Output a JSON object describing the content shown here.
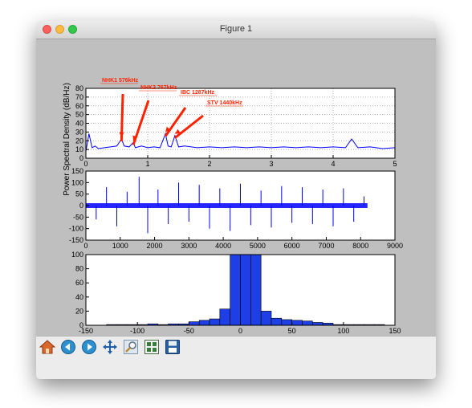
{
  "window": {
    "title": "Figure 1"
  },
  "toolbar": {
    "icons": [
      "home-icon",
      "back-icon",
      "forward-icon",
      "pan-icon",
      "zoom-icon",
      "subplots-icon",
      "save-icon"
    ]
  },
  "colors": {
    "series": "#0000ff",
    "annotation": "#ff2200",
    "canvas": "#bfbfbf",
    "hist_fill": "#1f3fe6"
  },
  "chart_data": [
    {
      "type": "line",
      "ylabel": "Power Spectral Density (dB/Hz)",
      "xlim": [
        0,
        5
      ],
      "ylim": [
        0,
        80
      ],
      "xticks": [
        "0",
        "1",
        "2",
        "3",
        "4",
        "5"
      ],
      "yticks": [
        "0",
        "10",
        "20",
        "30",
        "40",
        "50",
        "60",
        "70",
        "80"
      ],
      "grid": true,
      "x": [
        0.0,
        0.05,
        0.1,
        0.15,
        0.2,
        0.3,
        0.4,
        0.5,
        0.576,
        0.62,
        0.7,
        0.767,
        0.8,
        0.9,
        1.0,
        1.1,
        1.2,
        1.287,
        1.33,
        1.38,
        1.44,
        1.5,
        1.6,
        1.8,
        2.0,
        2.2,
        2.4,
        2.6,
        2.8,
        3.0,
        3.2,
        3.4,
        3.6,
        3.8,
        4.0,
        4.2,
        4.3,
        4.4,
        4.6,
        4.8,
        5.0
      ],
      "values": [
        8,
        28,
        12,
        14,
        11,
        12,
        13,
        14,
        22,
        14,
        13,
        18,
        12,
        14,
        12,
        13,
        12,
        28,
        14,
        13,
        26,
        13,
        14,
        12,
        13,
        12,
        13,
        12,
        13,
        12,
        13,
        12,
        13,
        12,
        13,
        12,
        22,
        12,
        13,
        11,
        12
      ],
      "annotations": [
        {
          "text": "NHK1 576kHz",
          "x": 0.576,
          "y": 22
        },
        {
          "text": "NHK2 767kHz",
          "x": 0.767,
          "y": 18
        },
        {
          "text": "IBC 1287kHz",
          "x": 1.287,
          "y": 28
        },
        {
          "text": "STV 1440kHz",
          "x": 1.44,
          "y": 26
        }
      ]
    },
    {
      "type": "line",
      "xlim": [
        0,
        9000
      ],
      "ylim": [
        -150,
        150
      ],
      "xticks": [
        "0",
        "1000",
        "2000",
        "3000",
        "4000",
        "5000",
        "6000",
        "7000",
        "8000",
        "9000"
      ],
      "yticks": [
        "-150",
        "-100",
        "-50",
        "0",
        "50",
        "100",
        "150"
      ],
      "grid": false,
      "x": [
        0,
        300,
        600,
        900,
        1200,
        1550,
        1800,
        2100,
        2400,
        2700,
        3000,
        3300,
        3600,
        3900,
        4200,
        4500,
        4800,
        5100,
        5400,
        5700,
        6000,
        6300,
        6600,
        6900,
        7200,
        7500,
        7800,
        8100,
        8200
      ],
      "values": [
        5,
        -60,
        80,
        -90,
        60,
        125,
        -120,
        70,
        -80,
        100,
        -70,
        90,
        -100,
        75,
        -110,
        95,
        -85,
        65,
        -95,
        85,
        -75,
        80,
        -80,
        70,
        -90,
        75,
        -70,
        40,
        0
      ],
      "envelope_note": ""
    },
    {
      "type": "bar",
      "xlim": [
        -150,
        150
      ],
      "ylim": [
        0,
        100
      ],
      "xticks": [
        "-150",
        "-100",
        "-50",
        "0",
        "50",
        "100",
        "150"
      ],
      "yticks": [
        "0",
        "20",
        "40",
        "60",
        "80",
        "100"
      ],
      "bin_width": 10,
      "bin_starts": [
        -130,
        -120,
        -110,
        -100,
        -90,
        -80,
        -70,
        -60,
        -50,
        -40,
        -30,
        -20,
        -10,
        0,
        10,
        20,
        30,
        40,
        50,
        60,
        70,
        80,
        90,
        100,
        110,
        120,
        130
      ],
      "values": [
        1,
        1,
        1,
        1,
        2,
        1,
        2,
        2,
        5,
        7,
        9,
        23,
        100,
        100,
        100,
        20,
        10,
        8,
        7,
        6,
        4,
        3,
        1,
        1,
        1,
        1,
        1
      ]
    }
  ]
}
